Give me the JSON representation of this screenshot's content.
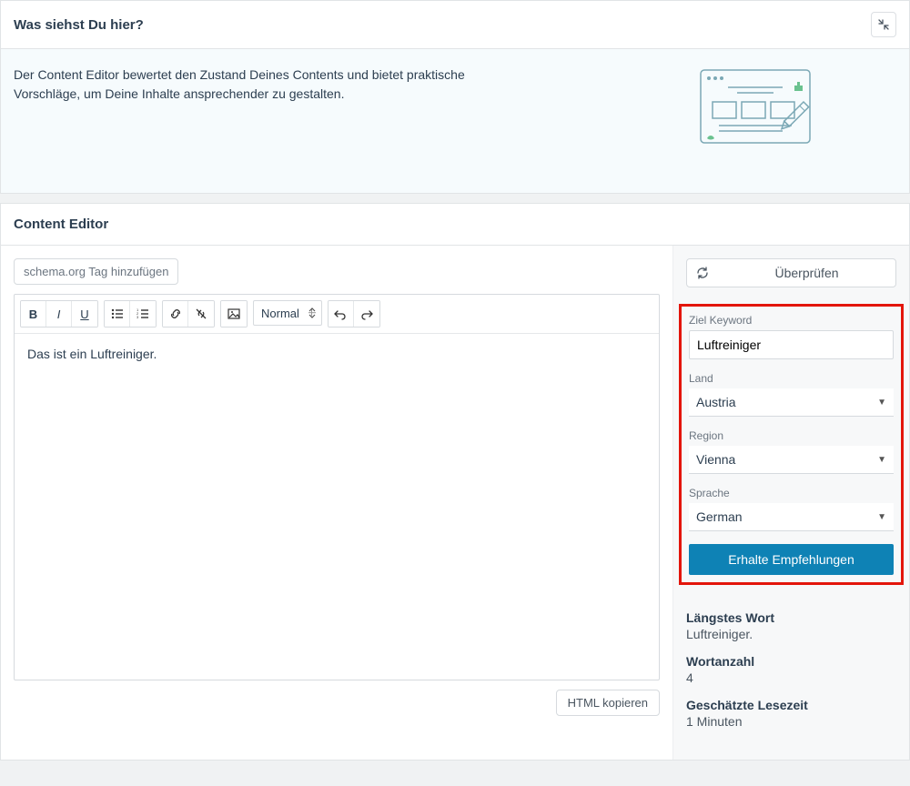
{
  "intro": {
    "title": "Was siehst Du hier?",
    "text": "Der Content Editor bewertet den Zustand Deines Contents und bietet praktische Vorschläge, um Deine Inhalte ansprechender zu gestalten."
  },
  "editor": {
    "section_title": "Content Editor",
    "schema_button": "schema.org Tag hinzufügen",
    "format_select": "Normal",
    "content": "Das ist ein Luftreiniger.",
    "html_copy": "HTML kopieren"
  },
  "sidebar": {
    "verify_label": "Überprüfen",
    "keyword_label": "Ziel Keyword",
    "keyword_value": "Luftreiniger",
    "country_label": "Land",
    "country_value": "Austria",
    "region_label": "Region",
    "region_value": "Vienna",
    "language_label": "Sprache",
    "language_value": "German",
    "cta": "Erhalte Empfehlungen"
  },
  "stats": {
    "longest_label": "Längstes Wort",
    "longest_value": "Luftreiniger.",
    "wordcount_label": "Wortanzahl",
    "wordcount_value": "4",
    "readtime_label": "Geschätzte Lesezeit",
    "readtime_value": "1 Minuten"
  }
}
